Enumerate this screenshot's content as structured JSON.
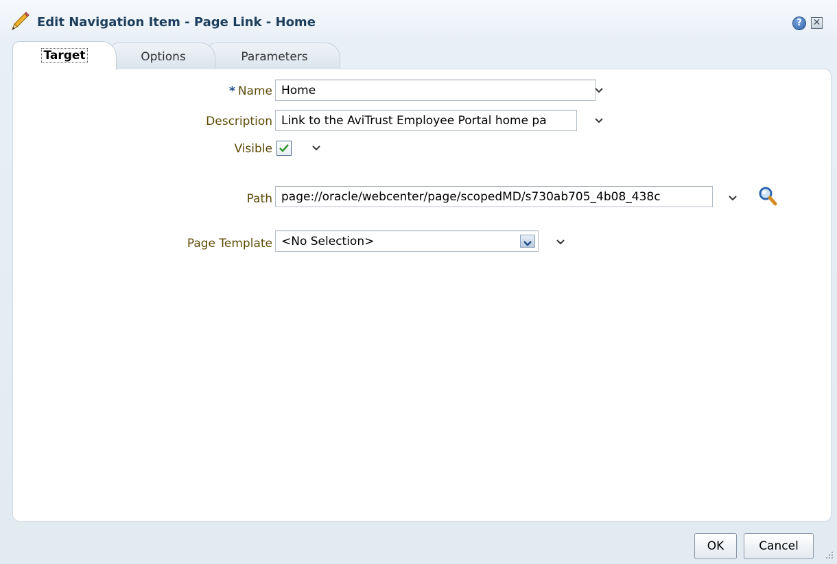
{
  "dialog": {
    "title": "Edit Navigation Item - Page Link - Home",
    "help_label": "?",
    "close_label": "✕"
  },
  "tabs": [
    {
      "label": "Target",
      "active": true
    },
    {
      "label": "Options",
      "active": false
    },
    {
      "label": "Parameters",
      "active": false
    }
  ],
  "form": {
    "name_required_marker": "*",
    "name_label": "Name",
    "name_value": "Home",
    "description_label": "Description",
    "description_value": "Link to the AviTrust Employee Portal home pa",
    "visible_label": "Visible",
    "visible_checked": true,
    "path_label": "Path",
    "path_value": "page://oracle/webcenter/page/scopedMD/s730ab705_4b08_438c",
    "page_template_label": "Page Template",
    "page_template_value": "<No Selection>"
  },
  "footer": {
    "ok_label": "OK",
    "cancel_label": "Cancel"
  },
  "colors": {
    "label": "#5c4a06",
    "title": "#1d3d5c",
    "checkmark": "#2f9a2f"
  },
  "icons": {
    "title": "pencil-icon",
    "help": "help-icon",
    "close": "close-icon",
    "search": "search-icon",
    "menu": "chevron-down-icon",
    "resize": "resize-grip-icon"
  }
}
